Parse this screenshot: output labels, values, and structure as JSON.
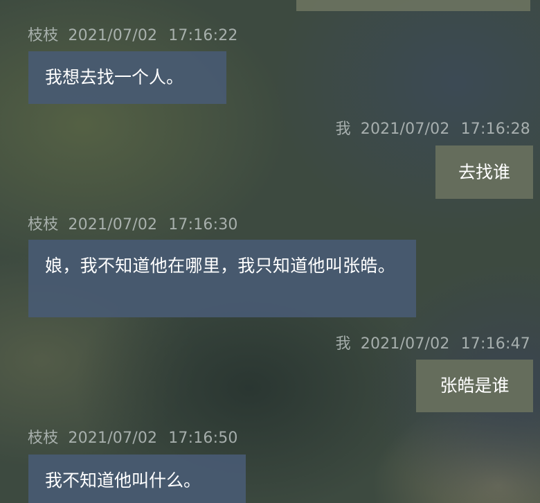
{
  "messages": [
    {
      "sender": "枝枝",
      "date": "2021/07/02",
      "time": "17:16:22",
      "text": "我想去找一个人。"
    },
    {
      "sender": "我",
      "date": "2021/07/02",
      "time": "17:16:28",
      "text": "去找谁"
    },
    {
      "sender": "枝枝",
      "date": "2021/07/02",
      "time": "17:16:30",
      "text": "娘，我不知道他在哪里，我只知道他叫张皓。"
    },
    {
      "sender": "我",
      "date": "2021/07/02",
      "time": "17:16:47",
      "text": "张皓是谁"
    },
    {
      "sender": "枝枝",
      "date": "2021/07/02",
      "time": "17:16:50",
      "text": "我不知道他叫什么。"
    }
  ],
  "colors": {
    "incoming_bubble": "#485a72",
    "outgoing_bubble": "#68705e",
    "meta_text": "#bec6c4",
    "message_text": "#ffffff"
  }
}
